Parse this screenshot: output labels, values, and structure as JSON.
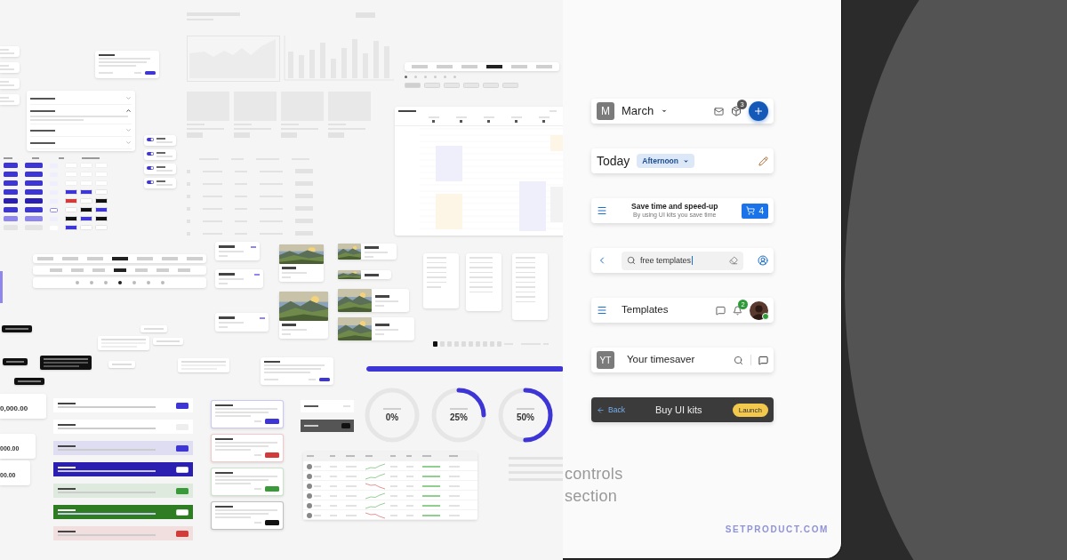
{
  "canvas": {
    "accordion": [
      {
        "expanded": false
      },
      {
        "expanded": true
      },
      {
        "expanded": false
      },
      {
        "expanded": false
      }
    ],
    "toggles": [
      {
        "on": true
      },
      {
        "on": true
      },
      {
        "on": true
      },
      {
        "on": true
      }
    ],
    "top_tabs": [
      {
        "selected": false
      },
      {
        "selected": false
      },
      {
        "selected": false
      },
      {
        "selected": true
      },
      {
        "selected": false
      },
      {
        "selected": false
      }
    ],
    "tabs": [
      {
        "selected": false
      },
      {
        "selected": false
      },
      {
        "selected": false
      },
      {
        "selected": true
      },
      {
        "selected": false
      },
      {
        "selected": false
      },
      {
        "selected": false
      }
    ],
    "sub_tabs": [
      {
        "selected": false
      },
      {
        "selected": false
      },
      {
        "selected": false
      },
      {
        "selected": true
      },
      {
        "selected": false
      },
      {
        "selected": false
      },
      {
        "selected": false
      }
    ],
    "pagination": [
      {
        "selected": true
      },
      {
        "selected": false
      },
      {
        "selected": false
      },
      {
        "selected": false
      },
      {
        "selected": false
      },
      {
        "selected": false
      },
      {
        "selected": false
      },
      {
        "selected": false
      },
      {
        "selected": false
      },
      {
        "selected": false
      }
    ],
    "progress": {
      "level": 1
    },
    "circles": [
      {
        "value": "0%"
      },
      {
        "value": "25%"
      },
      {
        "value": "50%"
      }
    ],
    "amounts": [
      {
        "value": "0,000.00"
      },
      {
        "value": "000.00"
      },
      {
        "value": "00.00"
      }
    ],
    "banners": [
      {
        "kind": "plain",
        "color": "#3d35d6"
      },
      {
        "kind": "plain",
        "color": "#eeeeee"
      },
      {
        "kind": "tint",
        "color": "#3d35d6"
      },
      {
        "kind": "solid",
        "color": "#2a1fb0"
      },
      {
        "kind": "tint",
        "color": "#3a9a3a"
      },
      {
        "kind": "solid",
        "color": "#2e7d23"
      },
      {
        "kind": "tint",
        "color": "#d33a3a"
      }
    ],
    "toasts": [
      {
        "color": "#3d35d6"
      },
      {
        "color": "#d33a3a"
      },
      {
        "color": "#3a9a3a"
      },
      {
        "color": "#111111"
      }
    ],
    "table_rows": [
      {
        "kind": "rising"
      },
      {
        "kind": "rising"
      },
      {
        "kind": "falling"
      },
      {
        "kind": "rising"
      },
      {
        "kind": "rising"
      },
      {
        "kind": "falling"
      }
    ]
  },
  "showcase": {
    "month_bar": {
      "avatar": "M",
      "title": "March",
      "badge": "3"
    },
    "today_bar": {
      "title": "Today",
      "chip": "Afternoon"
    },
    "promo_bar": {
      "title": "Save time and speed-up",
      "subtitle": "By using UI kits you save time",
      "cart_count": "4"
    },
    "search_bar": {
      "value": "free templates"
    },
    "templates_bar": {
      "title": "Templates",
      "badge": "2",
      "online": true
    },
    "timesaver_bar": {
      "avatar": "YT",
      "title": "Your timesaver"
    },
    "buy_bar": {
      "back": "Back",
      "title": "Buy UI kits",
      "action": "Launch"
    },
    "caption": [
      "controls",
      "section"
    ],
    "site": "SETPRODUCT.COM"
  }
}
